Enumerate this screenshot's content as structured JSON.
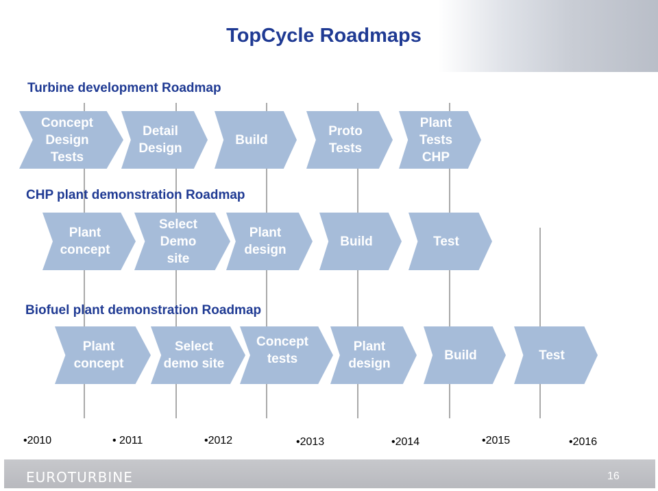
{
  "header": {
    "title": "TopCycle Roadmaps"
  },
  "turbine": {
    "title": "Turbine development Roadmap",
    "steps": [
      "Concept\nDesign\nTests",
      "Detail\nDesign",
      "Build",
      "Proto\nTests",
      "Plant\nTests\nCHP"
    ]
  },
  "chp": {
    "title": "CHP plant demonstration Roadmap",
    "steps": [
      "Plant\nconcept",
      "Select\nDemo\nsite",
      "Plant\ndesign",
      "Build",
      "Test"
    ]
  },
  "biofuel": {
    "title": "Biofuel plant demonstration Roadmap",
    "steps": [
      "Plant\nconcept",
      "Select\ndemo site",
      "Concept\ntests",
      "Plant\ndesign",
      "Build",
      "Test"
    ]
  },
  "timeline": {
    "years": [
      "•2010",
      "• 2011",
      "•2012",
      "•2013",
      "•2014",
      "•2015",
      "•2016"
    ]
  },
  "footer": {
    "brand": "EUROTURBINE",
    "page": "16"
  },
  "colors": {
    "accent": "#1f3a93",
    "chevron": "#a6bcd9"
  }
}
